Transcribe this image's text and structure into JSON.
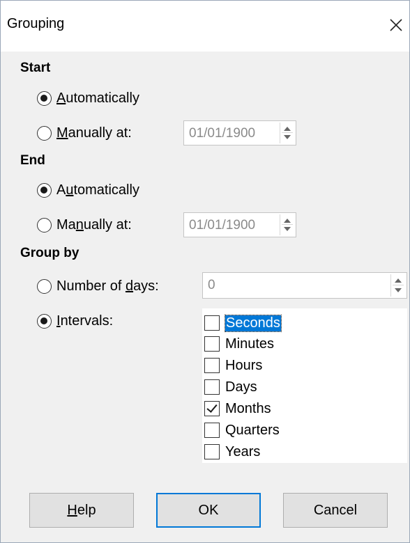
{
  "window": {
    "title": "Grouping"
  },
  "start": {
    "heading": "Start",
    "automatic": {
      "prefix": "",
      "mnemonic": "A",
      "rest": "utomatically",
      "checked": true
    },
    "manual": {
      "prefix": "",
      "mnemonic": "M",
      "rest": "anually at:",
      "checked": false,
      "value": "01/01/1900"
    }
  },
  "end": {
    "heading": "End",
    "automatic": {
      "prefix": "A",
      "mnemonic": "u",
      "rest": "tomatically",
      "checked": true
    },
    "manual": {
      "prefix": "Ma",
      "mnemonic": "n",
      "rest": "ually at:",
      "checked": false,
      "value": "01/01/1900"
    }
  },
  "group_by": {
    "heading": "Group by",
    "days": {
      "prefix": "Number of ",
      "mnemonic": "d",
      "rest": "ays:",
      "checked": false,
      "value": "0"
    },
    "intervals": {
      "prefix": "",
      "mnemonic": "I",
      "rest": "ntervals:",
      "checked": true
    },
    "interval_items": [
      {
        "label": "Seconds",
        "checked": false,
        "selected": true
      },
      {
        "label": "Minutes",
        "checked": false,
        "selected": false
      },
      {
        "label": "Hours",
        "checked": false,
        "selected": false
      },
      {
        "label": "Days",
        "checked": false,
        "selected": false
      },
      {
        "label": "Months",
        "checked": true,
        "selected": false
      },
      {
        "label": "Quarters",
        "checked": false,
        "selected": false
      },
      {
        "label": "Years",
        "checked": false,
        "selected": false
      }
    ]
  },
  "buttons": {
    "help": {
      "prefix": "",
      "mnemonic": "H",
      "rest": "elp"
    },
    "ok": "OK",
    "cancel": "Cancel"
  },
  "colors": {
    "accent": "#0078d7",
    "dialog_background": "#f0f0f0",
    "button_background": "#e1e1e1"
  }
}
